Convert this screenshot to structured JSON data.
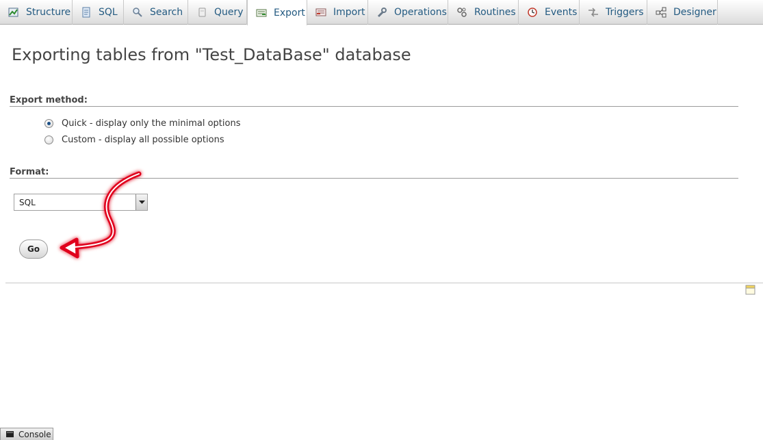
{
  "tabs": [
    {
      "label": "Structure",
      "icon": "structure-icon"
    },
    {
      "label": "SQL",
      "icon": "sql-icon"
    },
    {
      "label": "Search",
      "icon": "search-icon"
    },
    {
      "label": "Query",
      "icon": "query-icon"
    },
    {
      "label": "Export",
      "icon": "export-icon",
      "active": true
    },
    {
      "label": "Import",
      "icon": "import-icon"
    },
    {
      "label": "Operations",
      "icon": "wrench-icon"
    },
    {
      "label": "Routines",
      "icon": "routines-icon"
    },
    {
      "label": "Events",
      "icon": "clock-icon"
    },
    {
      "label": "Triggers",
      "icon": "triggers-icon"
    },
    {
      "label": "Designer",
      "icon": "designer-icon"
    }
  ],
  "page": {
    "title": "Exporting tables from \"Test_DataBase\" database"
  },
  "export_method": {
    "legend": "Export method:",
    "options": [
      {
        "label": "Quick - display only the minimal options",
        "checked": true
      },
      {
        "label": "Custom - display all possible options",
        "checked": false
      }
    ]
  },
  "format": {
    "legend": "Format:",
    "selected": "SQL"
  },
  "go_button": {
    "label": "Go"
  },
  "console": {
    "label": "Console"
  },
  "colors": {
    "tab_text": "#235a81",
    "annotation_arrow": "#e0001a",
    "radio_checked": "#1b4f86"
  }
}
